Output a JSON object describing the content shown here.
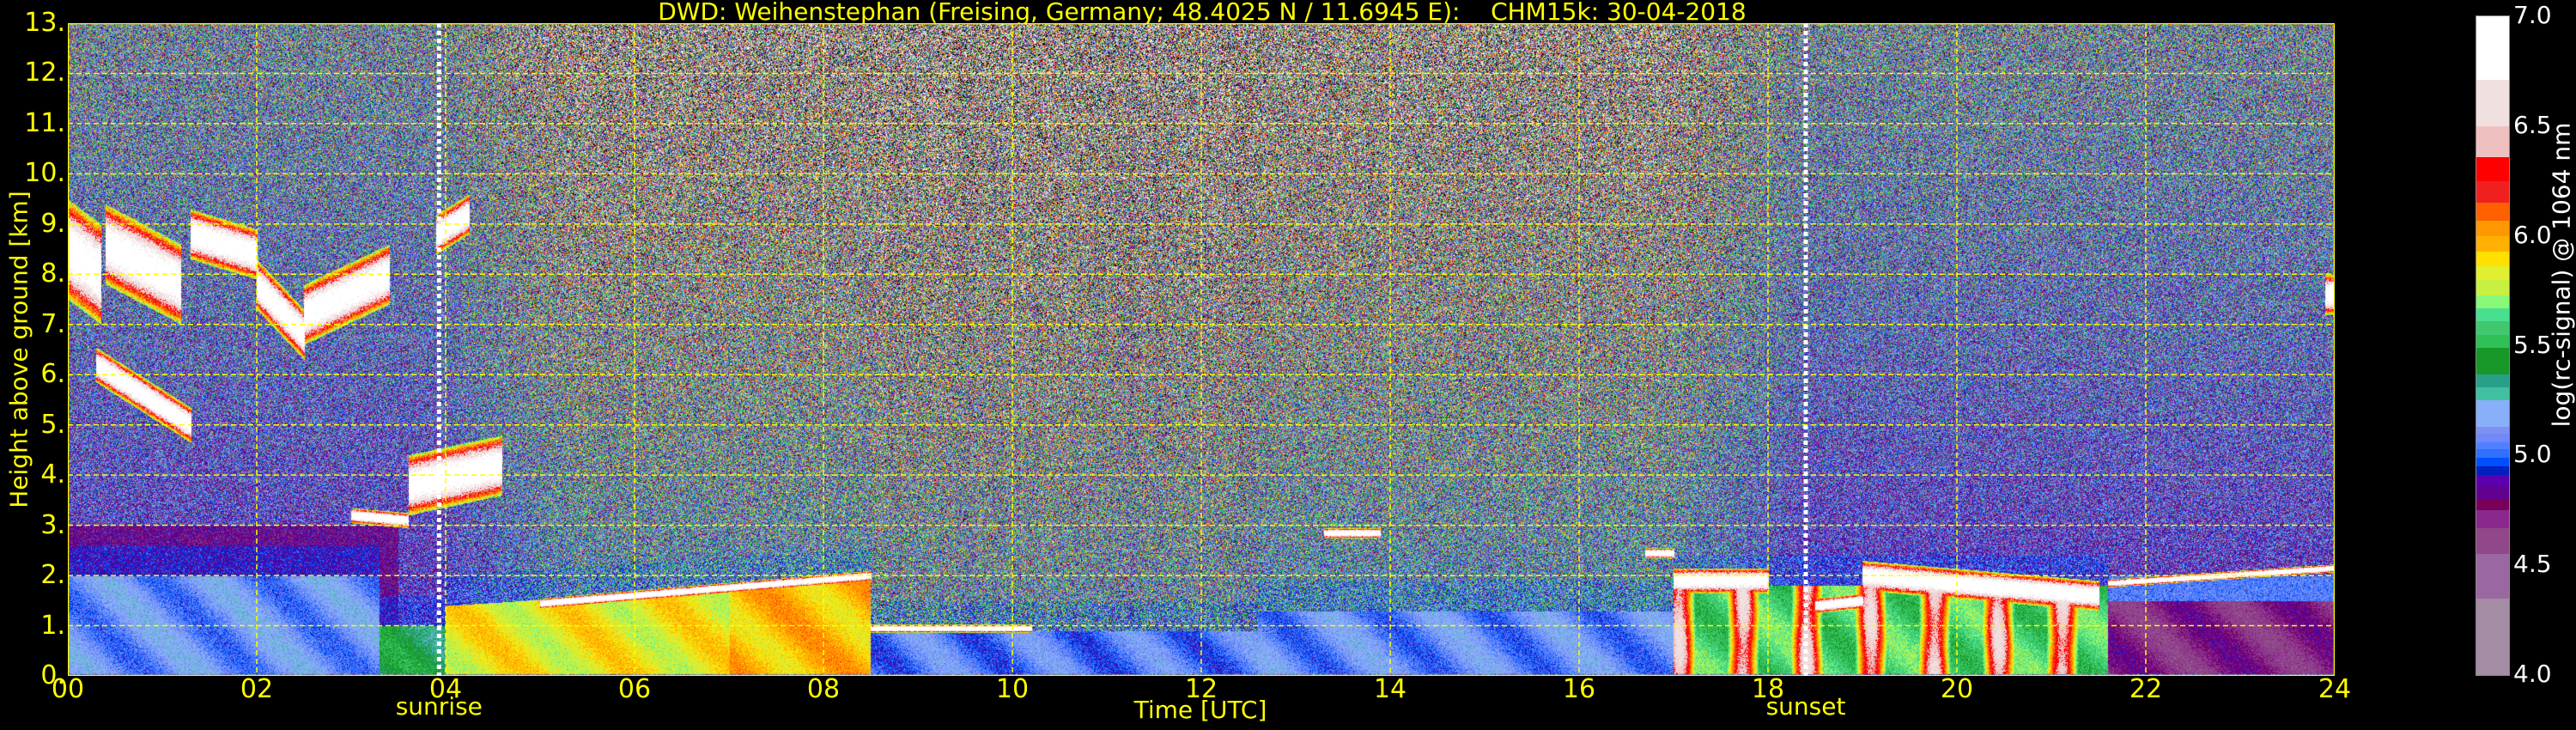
{
  "chart_data": {
    "type": "heatmap",
    "title": "DWD: Weihenstephan (Freising, Germany; 48.4025 N / 11.6945 E):    CHM15k: 30-04-2018",
    "xlabel": "Time [UTC]",
    "ylabel": "Height above ground [km]",
    "xlim": [
      0,
      24
    ],
    "ylim": [
      0,
      13
    ],
    "grid": true,
    "grid_color": "#ffff00",
    "x_ticks": [
      {
        "value": 0,
        "label": "00"
      },
      {
        "value": 2,
        "label": "02"
      },
      {
        "value": 4,
        "label": "04"
      },
      {
        "value": 6,
        "label": "06"
      },
      {
        "value": 8,
        "label": "08"
      },
      {
        "value": 10,
        "label": "10"
      },
      {
        "value": 12,
        "label": "12"
      },
      {
        "value": 14,
        "label": "14"
      },
      {
        "value": 16,
        "label": "16"
      },
      {
        "value": 18,
        "label": "18"
      },
      {
        "value": 20,
        "label": "20"
      },
      {
        "value": 22,
        "label": "22"
      },
      {
        "value": 24,
        "label": "24"
      }
    ],
    "y_ticks": [
      {
        "value": 0,
        "label": "0."
      },
      {
        "value": 1,
        "label": "1."
      },
      {
        "value": 2,
        "label": "2."
      },
      {
        "value": 3,
        "label": "3."
      },
      {
        "value": 4,
        "label": "4."
      },
      {
        "value": 5,
        "label": "5."
      },
      {
        "value": 6,
        "label": "6."
      },
      {
        "value": 7,
        "label": "7."
      },
      {
        "value": 8,
        "label": "8."
      },
      {
        "value": 9,
        "label": "9."
      },
      {
        "value": 10,
        "label": "10."
      },
      {
        "value": 11,
        "label": "11."
      },
      {
        "value": 12,
        "label": "12."
      },
      {
        "value": 13,
        "label": "13."
      }
    ],
    "annotations": [
      {
        "label": "sunrise",
        "x": 3.93,
        "line_color": "#ffffff"
      },
      {
        "label": "sunset",
        "x": 18.4,
        "line_color": "#ffffff"
      }
    ],
    "colorbar": {
      "label": "log(rc-signal) @ 1064 nm",
      "range": [
        4.0,
        7.0
      ],
      "ticks": [
        {
          "value": 4.0,
          "label": "4.0"
        },
        {
          "value": 4.5,
          "label": "4.5"
        },
        {
          "value": 5.0,
          "label": "5.0"
        },
        {
          "value": 5.5,
          "label": "5.5"
        },
        {
          "value": 6.0,
          "label": "6.0"
        },
        {
          "value": 6.5,
          "label": "6.5"
        },
        {
          "value": 7.0,
          "label": "7.0"
        }
      ],
      "levels": [
        [
          4.0,
          "#a48ca4"
        ],
        [
          4.35,
          "#9a68a0"
        ],
        [
          4.55,
          "#904888"
        ],
        [
          4.67,
          "#8a2890"
        ],
        [
          4.75,
          "#780058"
        ],
        [
          4.8,
          "#600090"
        ],
        [
          4.86,
          "#5a00b0"
        ],
        [
          4.91,
          "#0020c0"
        ],
        [
          4.95,
          "#0050ff"
        ],
        [
          4.99,
          "#3070ff"
        ],
        [
          5.03,
          "#5080ff"
        ],
        [
          5.06,
          "#7088f8"
        ],
        [
          5.1,
          "#8090f0"
        ],
        [
          5.13,
          "#88b0f8"
        ],
        [
          5.25,
          "#40c0a0"
        ],
        [
          5.31,
          "#28a088"
        ],
        [
          5.37,
          "#189828"
        ],
        [
          5.49,
          "#30c058"
        ],
        [
          5.55,
          "#40c870"
        ],
        [
          5.61,
          "#48e090"
        ],
        [
          5.67,
          "#88f878"
        ],
        [
          5.73,
          "#c8f040"
        ],
        [
          5.8,
          "#e0f030"
        ],
        [
          5.86,
          "#ffe000"
        ],
        [
          5.93,
          "#ffb000"
        ],
        [
          6.0,
          "#ff9800"
        ],
        [
          6.07,
          "#ff6000"
        ],
        [
          6.15,
          "#f02020"
        ],
        [
          6.25,
          "#ff0000"
        ],
        [
          6.36,
          "#f0c0c0"
        ],
        [
          6.5,
          "#f0e0e0"
        ],
        [
          6.71,
          "#ffffff"
        ]
      ],
      "below_range_color": "#000000"
    }
  }
}
